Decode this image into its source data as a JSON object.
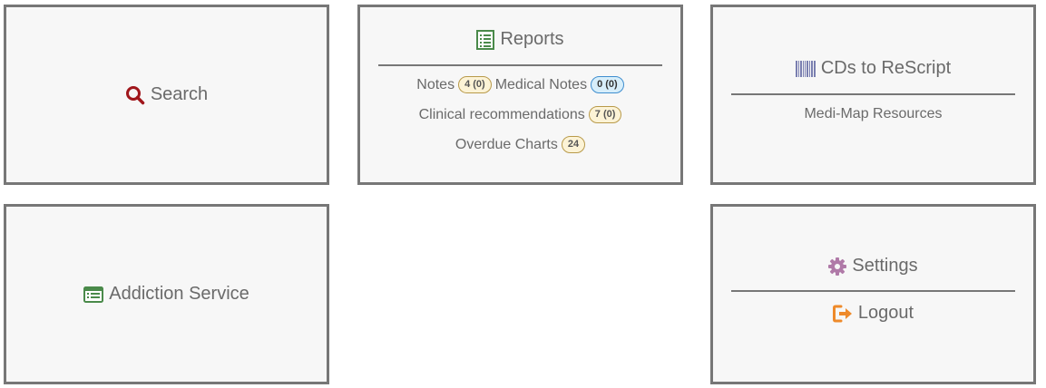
{
  "search": {
    "label": "Search"
  },
  "reports": {
    "title": "Reports",
    "notes_label": "Notes",
    "notes_badge": "4 (0)",
    "medical_notes_label": "Medical Notes",
    "medical_notes_badge": "0 (0)",
    "clinical_label": "Clinical recommendations",
    "clinical_badge": "7 (0)",
    "overdue_label": "Overdue Charts",
    "overdue_badge": "24"
  },
  "cds": {
    "title": "CDs to ReScript",
    "resources_label": "Medi-Map Resources"
  },
  "addiction": {
    "label": "Addiction Service"
  },
  "settings": {
    "settings_label": "Settings",
    "logout_label": "Logout"
  },
  "colors": {
    "search_icon": "#a0161b",
    "reports_icon": "#4a8a4a",
    "barcode_icon": "#7a7fb0",
    "addiction_icon": "#4a8a4a",
    "settings_icon": "#b07aa8",
    "logout_icon": "#ee8a2a",
    "badge_yellow_bg": "#fcf3d6",
    "badge_blue_bg": "#d7eefa"
  }
}
